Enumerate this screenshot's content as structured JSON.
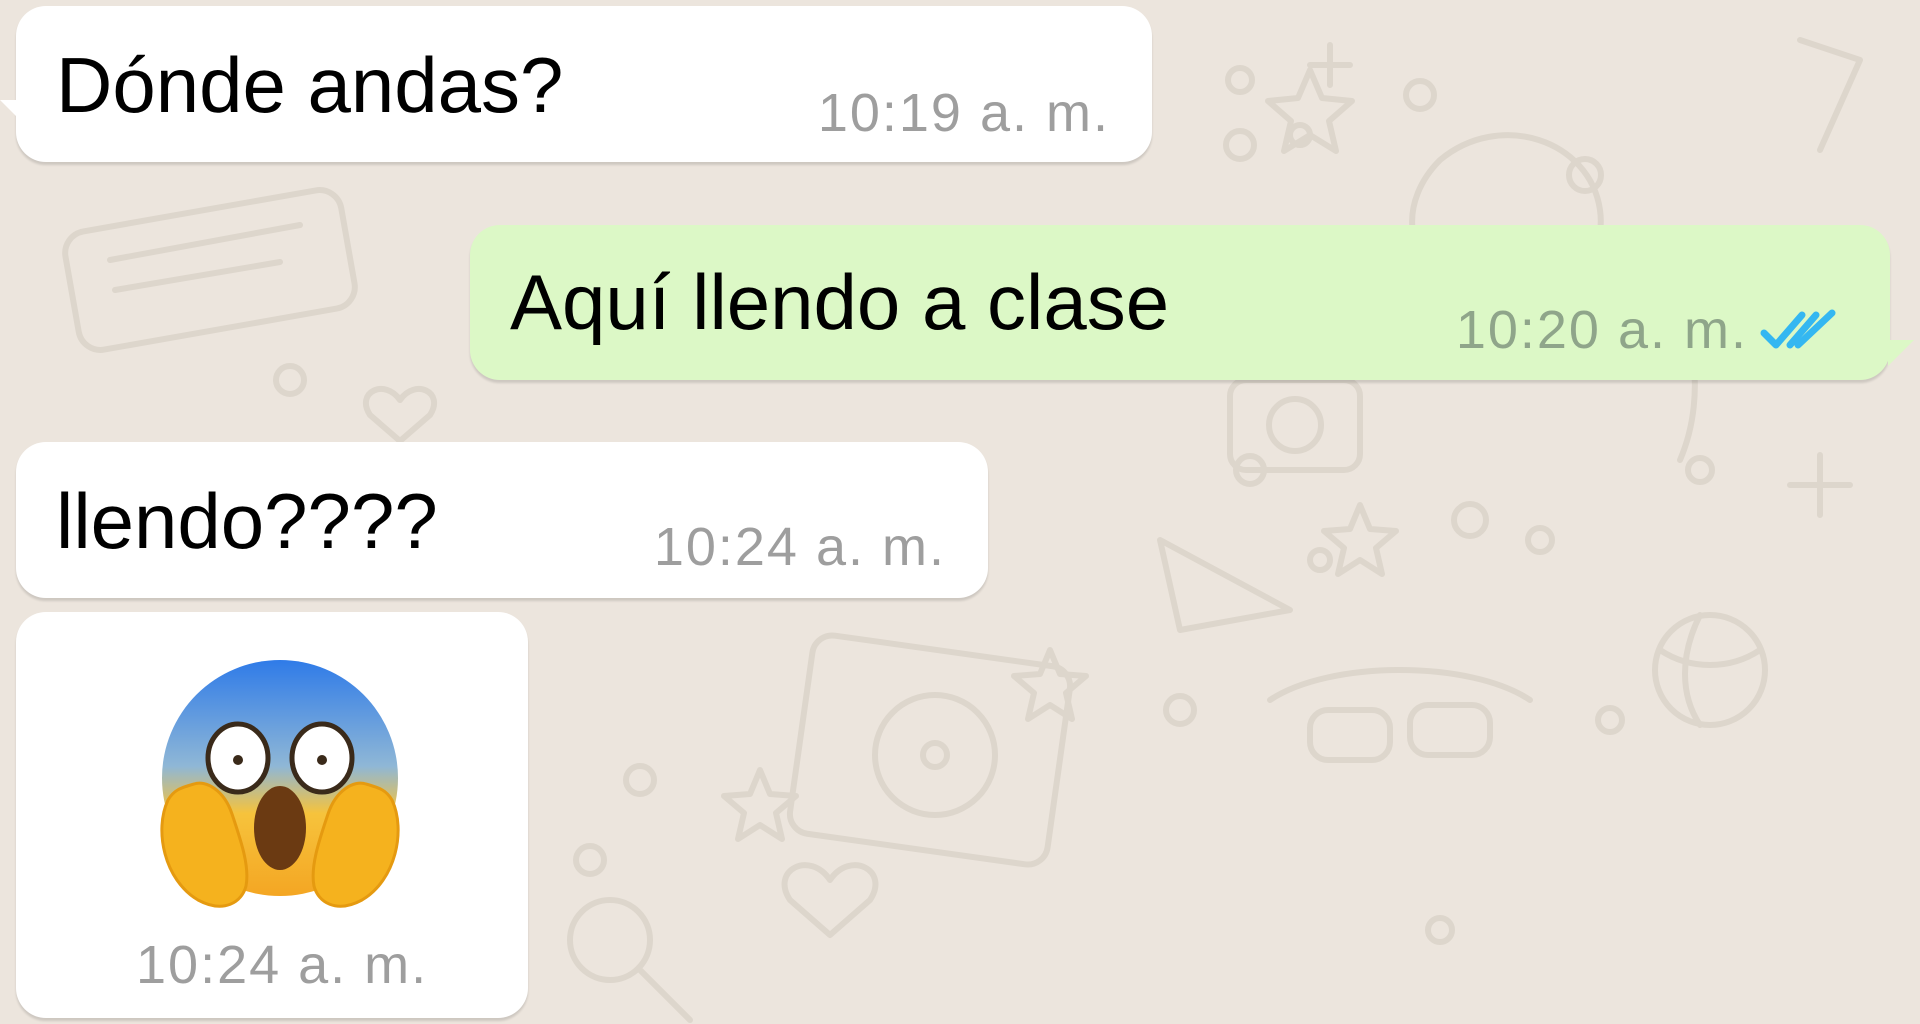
{
  "chat": {
    "messages": [
      {
        "direction": "incoming",
        "text": "Dónde andas?",
        "time": "10:19 a. m."
      },
      {
        "direction": "outgoing",
        "text": "Aquí llendo a clase",
        "time": "10:20 a. m.",
        "status": "read-double-check-icon",
        "status_color": "#34B7F1"
      },
      {
        "direction": "incoming",
        "text": "llendo????",
        "time": "10:24 a. m."
      },
      {
        "direction": "incoming",
        "emoji": "face-screaming-in-fear-icon",
        "time": "10:24 a. m."
      }
    ]
  },
  "colors": {
    "background": "#ECE5DD",
    "incoming_bubble": "#FFFFFF",
    "outgoing_bubble": "#DCF8C6",
    "timestamp": "#9E9E9E",
    "read_ticks": "#34B7F1"
  }
}
